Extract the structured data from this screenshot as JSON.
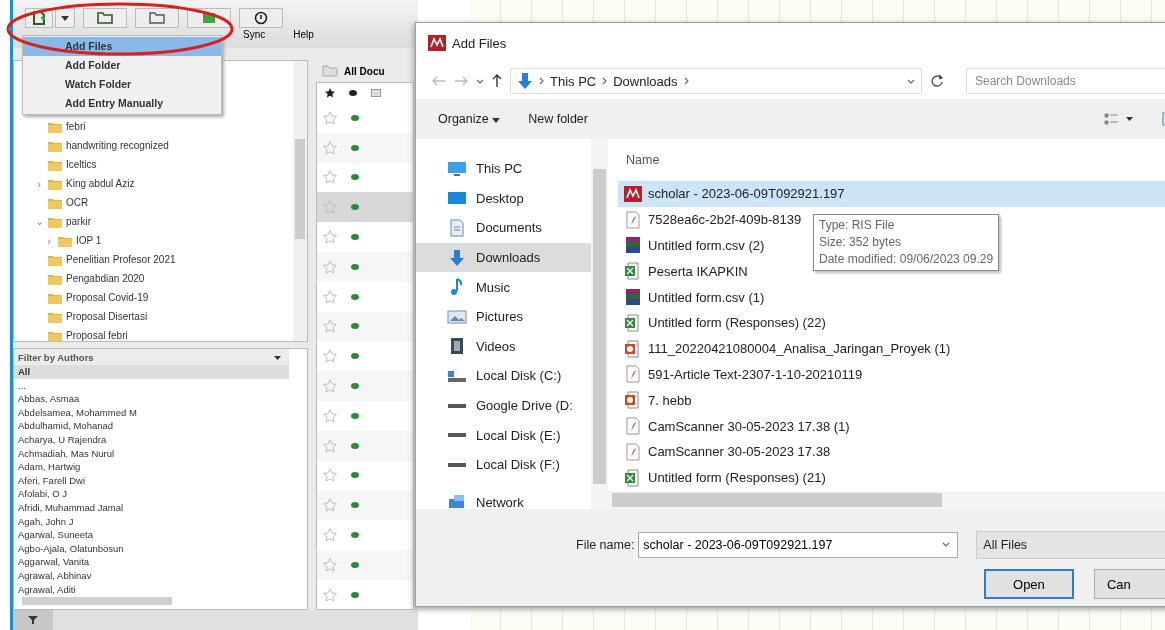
{
  "toolbar": {
    "labels": [
      "Sync",
      "Help"
    ]
  },
  "add_menu": {
    "items": [
      {
        "label": "Add Files",
        "selected": true
      },
      {
        "label": "Add Folder",
        "selected": false
      },
      {
        "label": "Watch Folder",
        "selected": false
      },
      {
        "label": "Add Entry Manually",
        "selected": false
      }
    ]
  },
  "folders": [
    {
      "label": "febri"
    },
    {
      "label": "handwriting recognized"
    },
    {
      "label": "Iceltics"
    },
    {
      "label": "King abdul Aziz",
      "expander": "›"
    },
    {
      "label": "OCR"
    },
    {
      "label": "parkir",
      "expander": "⌄",
      "children": [
        {
          "label": "IOP 1",
          "expander": "›"
        }
      ]
    },
    {
      "label": "Penelitian Profesor 2021"
    },
    {
      "label": "Pengabdian 2020"
    },
    {
      "label": "Proposal Covid-19"
    },
    {
      "label": "Proposal Disertasi"
    },
    {
      "label": "Proposal febri"
    }
  ],
  "author_filter": {
    "title": "Filter by Authors",
    "items": [
      {
        "label": "All",
        "selected": true
      },
      {
        "label": "...",
        "selected": false
      },
      {
        "label": "Abbas, Asmaa",
        "selected": false
      },
      {
        "label": "Abdelsamea, Mohammed M",
        "selected": false
      },
      {
        "label": "Abdulhamid, Mohanad",
        "selected": false
      },
      {
        "label": "Acharya, U Rajendra",
        "selected": false
      },
      {
        "label": "Achmadiah, Mas Nurul",
        "selected": false
      },
      {
        "label": "Adam, Hartwig",
        "selected": false
      },
      {
        "label": "Aferi, Farell Dwi",
        "selected": false
      },
      {
        "label": "Afolabi, O J",
        "selected": false
      },
      {
        "label": "Afridi, Muhammad Jamal",
        "selected": false
      },
      {
        "label": "Agah, John J",
        "selected": false
      },
      {
        "label": "Agarwal, Suneeta",
        "selected": false
      },
      {
        "label": "Agbo-Ajala, Olatunbosun",
        "selected": false
      },
      {
        "label": "Aggarwal, Vanita",
        "selected": false
      },
      {
        "label": "Agrawal, Abhinav",
        "selected": false
      },
      {
        "label": "Agrawal, Aditi",
        "selected": false
      }
    ]
  },
  "documents": {
    "title": "All Docu",
    "rows": [
      {
        "starred": false,
        "selected": false
      },
      {
        "starred": false,
        "selected": false
      },
      {
        "starred": false,
        "selected": false
      },
      {
        "starred": false,
        "selected": true
      },
      {
        "starred": false,
        "selected": false
      },
      {
        "starred": false,
        "selected": false
      },
      {
        "starred": false,
        "selected": false
      },
      {
        "starred": false,
        "selected": false
      },
      {
        "starred": false,
        "selected": false
      },
      {
        "starred": false,
        "selected": false
      },
      {
        "starred": false,
        "selected": false
      },
      {
        "starred": false,
        "selected": false
      },
      {
        "starred": false,
        "selected": false
      },
      {
        "starred": false,
        "selected": false
      },
      {
        "starred": false,
        "selected": false
      },
      {
        "starred": false,
        "selected": false
      },
      {
        "starred": false,
        "selected": false
      }
    ]
  },
  "dialog": {
    "title": "Add Files",
    "path": [
      "This PC",
      "Downloads"
    ],
    "search": {
      "placeholder": "Search Downloads"
    },
    "commands": [
      "Organize",
      "New folder"
    ],
    "nav": [
      {
        "label": "This PC",
        "kind": "computer",
        "selected": false
      },
      {
        "label": "Desktop",
        "kind": "desktop",
        "selected": false
      },
      {
        "label": "Documents",
        "kind": "documents",
        "selected": false
      },
      {
        "label": "Downloads",
        "kind": "downloads",
        "selected": true
      },
      {
        "label": "Music",
        "kind": "music",
        "selected": false
      },
      {
        "label": "Pictures",
        "kind": "pictures",
        "selected": false
      },
      {
        "label": "Videos",
        "kind": "videos",
        "selected": false
      },
      {
        "label": "Local Disk (C:)",
        "kind": "system-disk",
        "selected": false
      },
      {
        "label": "Google Drive (D:",
        "kind": "disk",
        "selected": false
      },
      {
        "label": "Local Disk (E:)",
        "kind": "disk",
        "selected": false
      },
      {
        "label": "Local Disk (F:)",
        "kind": "disk",
        "selected": false
      },
      {
        "label": "Network",
        "kind": "network",
        "selected": false
      }
    ],
    "column": "Name",
    "files": [
      {
        "name": "scholar - 2023-06-09T092921.197",
        "kind": "app",
        "selected": true
      },
      {
        "name": "7528ea6c-2b2f-409b-8139",
        "kind": "pdf",
        "selected": false
      },
      {
        "name": "Untitled form.csv (2)",
        "kind": "archive",
        "selected": false
      },
      {
        "name": "Peserta IKAPKIN",
        "kind": "sheet",
        "selected": false
      },
      {
        "name": "Untitled form.csv (1)",
        "kind": "archive",
        "selected": false
      },
      {
        "name": "Untitled form (Responses) (22)",
        "kind": "sheet",
        "selected": false
      },
      {
        "name": "111_20220421080004_Analisa_Jaringan_Proyek (1)",
        "kind": "slides",
        "selected": false
      },
      {
        "name": "591-Article Text-2307-1-10-20210119",
        "kind": "pdf",
        "selected": false
      },
      {
        "name": "7. hebb",
        "kind": "slides",
        "selected": false
      },
      {
        "name": "CamScanner 30-05-2023 17.38 (1)",
        "kind": "pdf",
        "selected": false
      },
      {
        "name": "CamScanner 30-05-2023 17.38",
        "kind": "pdf",
        "selected": false
      },
      {
        "name": "Untitled form (Responses) (21)",
        "kind": "sheet",
        "selected": false
      }
    ],
    "tooltip": [
      "Type: RIS File",
      "Size: 352 bytes",
      "Date modified: 09/06/2023 09.29"
    ],
    "file_name_label": "File name:",
    "file_name": "scholar - 2023-06-09T092921.197",
    "file_type": "All Files",
    "buttons": [
      "Open",
      "Can"
    ]
  }
}
